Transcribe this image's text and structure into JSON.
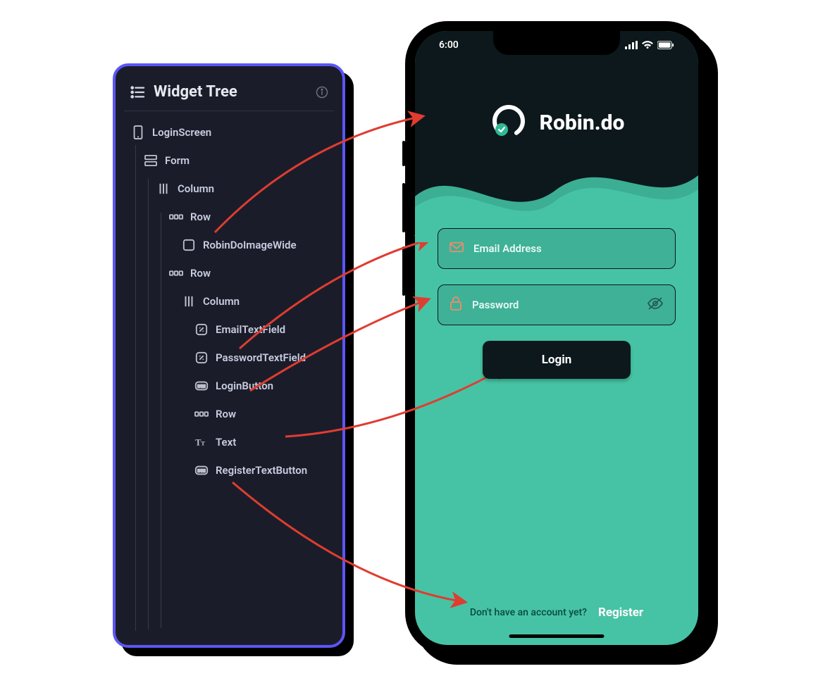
{
  "panel": {
    "title": "Widget Tree"
  },
  "tree": {
    "n0": "LoginScreen",
    "n1": "Form",
    "n2": "Column",
    "n3": "Row",
    "n4": "RobinDoImageWide",
    "n5": "Row",
    "n6": "Column",
    "n7": "EmailTextField",
    "n8": "PasswordTextField",
    "n9": "LoginButton",
    "n10": "Row",
    "n11": "Text",
    "n12": "RegisterTextButton"
  },
  "phone": {
    "time": "6:00",
    "brand": "Robin.do",
    "email_ph": "Email Address",
    "password_ph": "Password",
    "login_label": "Login",
    "register_q": "Don't have an account yet?",
    "register_label": "Register"
  },
  "colors": {
    "accent_teal": "#46c3a4",
    "panel_border": "#5b56f5",
    "dark": "#0c181b"
  }
}
